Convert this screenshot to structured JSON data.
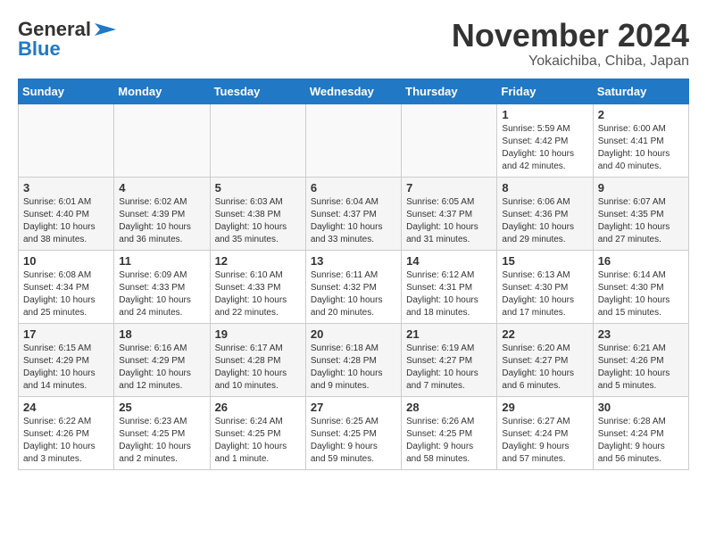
{
  "header": {
    "logo_line1": "General",
    "logo_line2": "Blue",
    "title": "November 2024",
    "subtitle": "Yokaichiba, Chiba, Japan"
  },
  "days_of_week": [
    "Sunday",
    "Monday",
    "Tuesday",
    "Wednesday",
    "Thursday",
    "Friday",
    "Saturday"
  ],
  "weeks": [
    [
      {
        "day": "",
        "content": ""
      },
      {
        "day": "",
        "content": ""
      },
      {
        "day": "",
        "content": ""
      },
      {
        "day": "",
        "content": ""
      },
      {
        "day": "",
        "content": ""
      },
      {
        "day": "1",
        "content": "Sunrise: 5:59 AM\nSunset: 4:42 PM\nDaylight: 10 hours\nand 42 minutes."
      },
      {
        "day": "2",
        "content": "Sunrise: 6:00 AM\nSunset: 4:41 PM\nDaylight: 10 hours\nand 40 minutes."
      }
    ],
    [
      {
        "day": "3",
        "content": "Sunrise: 6:01 AM\nSunset: 4:40 PM\nDaylight: 10 hours\nand 38 minutes."
      },
      {
        "day": "4",
        "content": "Sunrise: 6:02 AM\nSunset: 4:39 PM\nDaylight: 10 hours\nand 36 minutes."
      },
      {
        "day": "5",
        "content": "Sunrise: 6:03 AM\nSunset: 4:38 PM\nDaylight: 10 hours\nand 35 minutes."
      },
      {
        "day": "6",
        "content": "Sunrise: 6:04 AM\nSunset: 4:37 PM\nDaylight: 10 hours\nand 33 minutes."
      },
      {
        "day": "7",
        "content": "Sunrise: 6:05 AM\nSunset: 4:37 PM\nDaylight: 10 hours\nand 31 minutes."
      },
      {
        "day": "8",
        "content": "Sunrise: 6:06 AM\nSunset: 4:36 PM\nDaylight: 10 hours\nand 29 minutes."
      },
      {
        "day": "9",
        "content": "Sunrise: 6:07 AM\nSunset: 4:35 PM\nDaylight: 10 hours\nand 27 minutes."
      }
    ],
    [
      {
        "day": "10",
        "content": "Sunrise: 6:08 AM\nSunset: 4:34 PM\nDaylight: 10 hours\nand 25 minutes."
      },
      {
        "day": "11",
        "content": "Sunrise: 6:09 AM\nSunset: 4:33 PM\nDaylight: 10 hours\nand 24 minutes."
      },
      {
        "day": "12",
        "content": "Sunrise: 6:10 AM\nSunset: 4:33 PM\nDaylight: 10 hours\nand 22 minutes."
      },
      {
        "day": "13",
        "content": "Sunrise: 6:11 AM\nSunset: 4:32 PM\nDaylight: 10 hours\nand 20 minutes."
      },
      {
        "day": "14",
        "content": "Sunrise: 6:12 AM\nSunset: 4:31 PM\nDaylight: 10 hours\nand 18 minutes."
      },
      {
        "day": "15",
        "content": "Sunrise: 6:13 AM\nSunset: 4:30 PM\nDaylight: 10 hours\nand 17 minutes."
      },
      {
        "day": "16",
        "content": "Sunrise: 6:14 AM\nSunset: 4:30 PM\nDaylight: 10 hours\nand 15 minutes."
      }
    ],
    [
      {
        "day": "17",
        "content": "Sunrise: 6:15 AM\nSunset: 4:29 PM\nDaylight: 10 hours\nand 14 minutes."
      },
      {
        "day": "18",
        "content": "Sunrise: 6:16 AM\nSunset: 4:29 PM\nDaylight: 10 hours\nand 12 minutes."
      },
      {
        "day": "19",
        "content": "Sunrise: 6:17 AM\nSunset: 4:28 PM\nDaylight: 10 hours\nand 10 minutes."
      },
      {
        "day": "20",
        "content": "Sunrise: 6:18 AM\nSunset: 4:28 PM\nDaylight: 10 hours\nand 9 minutes."
      },
      {
        "day": "21",
        "content": "Sunrise: 6:19 AM\nSunset: 4:27 PM\nDaylight: 10 hours\nand 7 minutes."
      },
      {
        "day": "22",
        "content": "Sunrise: 6:20 AM\nSunset: 4:27 PM\nDaylight: 10 hours\nand 6 minutes."
      },
      {
        "day": "23",
        "content": "Sunrise: 6:21 AM\nSunset: 4:26 PM\nDaylight: 10 hours\nand 5 minutes."
      }
    ],
    [
      {
        "day": "24",
        "content": "Sunrise: 6:22 AM\nSunset: 4:26 PM\nDaylight: 10 hours\nand 3 minutes."
      },
      {
        "day": "25",
        "content": "Sunrise: 6:23 AM\nSunset: 4:25 PM\nDaylight: 10 hours\nand 2 minutes."
      },
      {
        "day": "26",
        "content": "Sunrise: 6:24 AM\nSunset: 4:25 PM\nDaylight: 10 hours\nand 1 minute."
      },
      {
        "day": "27",
        "content": "Sunrise: 6:25 AM\nSunset: 4:25 PM\nDaylight: 9 hours\nand 59 minutes."
      },
      {
        "day": "28",
        "content": "Sunrise: 6:26 AM\nSunset: 4:25 PM\nDaylight: 9 hours\nand 58 minutes."
      },
      {
        "day": "29",
        "content": "Sunrise: 6:27 AM\nSunset: 4:24 PM\nDaylight: 9 hours\nand 57 minutes."
      },
      {
        "day": "30",
        "content": "Sunrise: 6:28 AM\nSunset: 4:24 PM\nDaylight: 9 hours\nand 56 minutes."
      }
    ]
  ]
}
